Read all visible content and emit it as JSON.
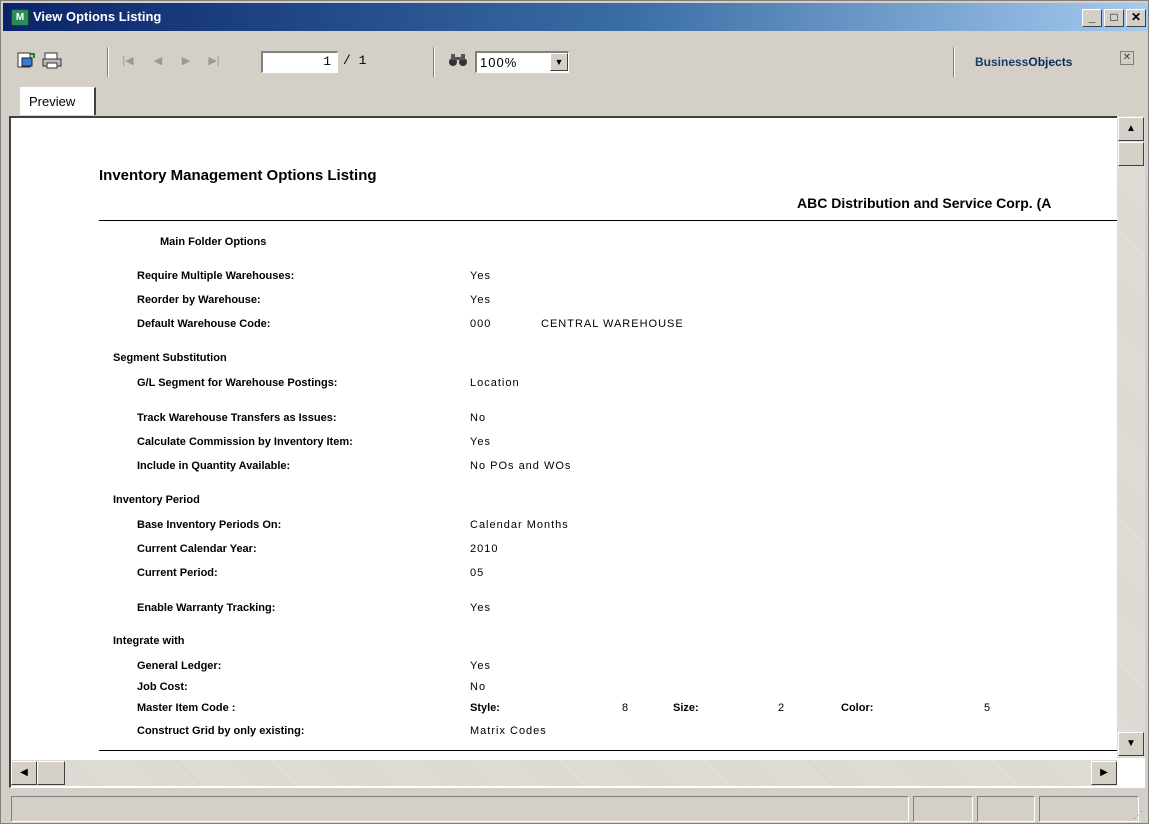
{
  "window": {
    "title": "View Options Listing",
    "app_icon_text": "M"
  },
  "toolbar": {
    "current_page": "1",
    "page_total": "/ 1",
    "zoom": "100%",
    "brand_left": "Business",
    "brand_right": "Objects"
  },
  "tab": {
    "label": "Preview"
  },
  "report": {
    "title": "Inventory Management Options Listing",
    "company": "ABC Distribution and Service Corp. (A",
    "sections": {
      "main_folder": "Main Folder Options",
      "segment": "Segment Substitution",
      "inventory_period": "Inventory Period",
      "integrate": "Integrate with"
    },
    "rows": {
      "require_multi_wh": {
        "label": "Require Multiple Warehouses:",
        "value": "Yes"
      },
      "reorder_by_wh": {
        "label": "Reorder by Warehouse:",
        "value": "Yes"
      },
      "default_wh_code": {
        "label": "Default Warehouse Code:",
        "value": "000",
        "extra": "CENTRAL WAREHOUSE"
      },
      "gl_segment": {
        "label": "G/L Segment for Warehouse Postings:",
        "value": "Location"
      },
      "track_transfers": {
        "label": "Track Warehouse Transfers as Issues:",
        "value": "No"
      },
      "calc_commission": {
        "label": "Calculate Commission by Inventory Item:",
        "value": "Yes"
      },
      "include_qty": {
        "label": "Include in Quantity Available:",
        "value": "No POs and WOs"
      },
      "base_periods": {
        "label": "Base Inventory Periods On:",
        "value": "Calendar Months"
      },
      "current_year": {
        "label": "Current Calendar Year:",
        "value": "2010"
      },
      "current_period": {
        "label": "Current Period:",
        "value": "05"
      },
      "warranty": {
        "label": "Enable Warranty Tracking:",
        "value": "Yes"
      },
      "general_ledger": {
        "label": "General Ledger:",
        "value": "Yes"
      },
      "job_cost": {
        "label": "Job Cost:",
        "value": "No"
      },
      "master_item": {
        "label": "Master Item Code :",
        "style_label": "Style:",
        "style_value": "8",
        "size_label": "Size:",
        "size_value": "2",
        "color_label": "Color:",
        "color_value": "5"
      },
      "construct_grid": {
        "label": "Construct Grid by only existing:",
        "value": "Matrix Codes"
      }
    }
  }
}
